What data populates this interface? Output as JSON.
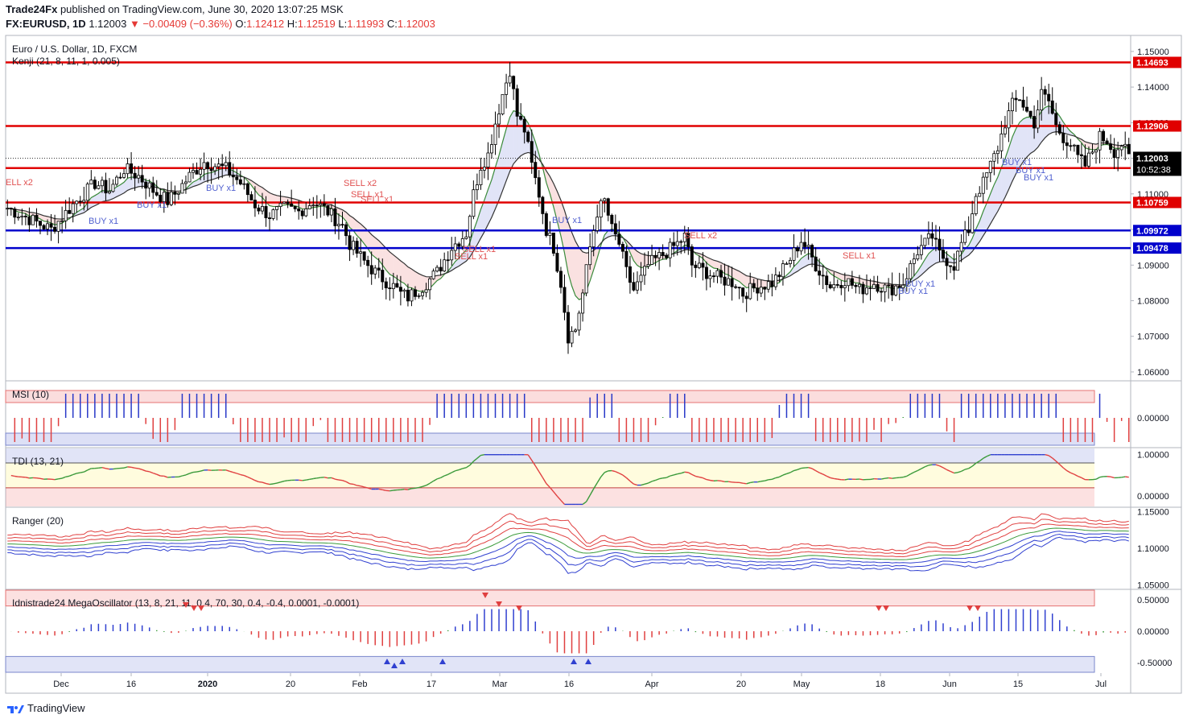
{
  "header": {
    "publisher": "Trade24Fx",
    "published_text": "published on TradingView.com, June 30, 2020 13:07:25 MSK",
    "symbol": "FX:EURUSD, 1D",
    "last": "1.12003",
    "change": "▼ −0.00409 (−0.36%)",
    "o_label": "O:",
    "o_value": "1.12412",
    "h_label": "H:",
    "h_value": "1.12519",
    "l_label": "L:",
    "l_value": "1.11993",
    "c_label": "C:",
    "c_value": "1.12003"
  },
  "footer": {
    "brand": "TradingView"
  },
  "colors": {
    "up": "#ffffff",
    "down": "#000000",
    "red_line": "#e00000",
    "blue_line": "#0000cc",
    "buy": "#5060d0",
    "sell": "#e05050"
  },
  "chart_data": [
    {
      "type": "candlestick",
      "title": "Euro / U.S. Dollar, 1D, FXCM",
      "indicator_label": "Kenji (21, 8, 11, 1, 0.005)",
      "ylim": [
        1.0575,
        1.1545
      ],
      "y_ticks": [
        "1.15000",
        "1.14000",
        "1.13000",
        "1.12000",
        "1.11000",
        "1.10000",
        "1.09000",
        "1.08000",
        "1.07000",
        "1.06000"
      ],
      "x_labels": [
        "Dec",
        "16",
        "2020",
        "20",
        "Feb",
        "17",
        "Mar",
        "16",
        "Apr",
        "20",
        "May",
        "18",
        "Jun",
        "15",
        "Jul"
      ],
      "horizontal_levels": [
        {
          "value": 1.14693,
          "label": "1.14693",
          "color": "#e00000"
        },
        {
          "value": 1.12906,
          "label": "1.12906",
          "color": "#e00000"
        },
        {
          "value": 1.11726,
          "label": "1.11726",
          "color": "#e00000"
        },
        {
          "value": 1.10759,
          "label": "1.10759",
          "color": "#e00000"
        },
        {
          "value": 1.09972,
          "label": "1.09972",
          "color": "#0000cc"
        },
        {
          "value": 1.09478,
          "label": "1.09478",
          "color": "#0000cc"
        }
      ],
      "current_price": {
        "value": 1.12003,
        "label": "1.12003",
        "countdown": "10:52:38"
      },
      "signals": [
        "ELL x2",
        "BUY x1",
        "BUY x1",
        "BUY x1",
        "SELL x2",
        "SELL x1",
        "SELL x1",
        "SELL x1",
        "SELL x1",
        "BUY x1",
        "SELL x2",
        "SELL x1",
        "BUY x1",
        "BUY x1",
        "BUY x1",
        "BUY x1",
        "BUY x1"
      ],
      "close_path": [
        [
          0,
          1.106
        ],
        [
          6,
          1.103
        ],
        [
          12,
          1.1
        ],
        [
          18,
          1.107
        ],
        [
          24,
          1.113
        ],
        [
          28,
          1.111
        ],
        [
          32,
          1.117
        ],
        [
          36,
          1.115
        ],
        [
          40,
          1.111
        ],
        [
          44,
          1.108
        ],
        [
          46,
          1.11
        ],
        [
          50,
          1.115
        ],
        [
          54,
          1.119
        ],
        [
          60,
          1.117
        ],
        [
          64,
          1.113
        ],
        [
          68,
          1.107
        ],
        [
          72,
          1.104
        ],
        [
          76,
          1.106
        ],
        [
          80,
          1.105
        ],
        [
          84,
          1.108
        ],
        [
          88,
          1.105
        ],
        [
          92,
          1.101
        ],
        [
          94,
          1.096
        ],
        [
          98,
          1.091
        ],
        [
          102,
          1.087
        ],
        [
          106,
          1.084
        ],
        [
          108,
          1.082
        ],
        [
          110,
          1.081
        ],
        [
          114,
          1.084
        ],
        [
          118,
          1.088
        ],
        [
          122,
          1.095
        ],
        [
          126,
          1.099
        ],
        [
          128,
          1.11
        ],
        [
          130,
          1.118
        ],
        [
          132,
          1.121
        ],
        [
          134,
          1.13
        ],
        [
          136,
          1.138
        ],
        [
          138,
          1.145
        ],
        [
          140,
          1.132
        ],
        [
          142,
          1.128
        ],
        [
          144,
          1.118
        ],
        [
          146,
          1.11
        ],
        [
          148,
          1.1
        ],
        [
          150,
          1.095
        ],
        [
          152,
          1.085
        ],
        [
          154,
          1.07
        ],
        [
          156,
          1.072
        ],
        [
          158,
          1.082
        ],
        [
          160,
          1.095
        ],
        [
          162,
          1.105
        ],
        [
          164,
          1.108
        ],
        [
          166,
          1.1
        ],
        [
          168,
          1.096
        ],
        [
          170,
          1.088
        ],
        [
          172,
          1.083
        ],
        [
          174,
          1.086
        ],
        [
          176,
          1.09
        ],
        [
          180,
          1.093
        ],
        [
          184,
          1.096
        ],
        [
          186,
          1.098
        ],
        [
          188,
          1.09
        ],
        [
          192,
          1.088
        ],
        [
          196,
          1.086
        ],
        [
          200,
          1.085
        ],
        [
          202,
          1.082
        ],
        [
          206,
          1.084
        ],
        [
          210,
          1.085
        ],
        [
          214,
          1.09
        ],
        [
          218,
          1.097
        ],
        [
          220,
          1.094
        ],
        [
          222,
          1.09
        ],
        [
          226,
          1.084
        ],
        [
          230,
          1.086
        ],
        [
          234,
          1.083
        ],
        [
          238,
          1.085
        ],
        [
          242,
          1.083
        ],
        [
          246,
          1.085
        ],
        [
          250,
          1.094
        ],
        [
          254,
          1.098
        ],
        [
          256,
          1.093
        ],
        [
          260,
          1.09
        ],
        [
          262,
          1.096
        ],
        [
          264,
          1.1
        ],
        [
          266,
          1.11
        ],
        [
          268,
          1.113
        ],
        [
          270,
          1.118
        ],
        [
          272,
          1.123
        ],
        [
          274,
          1.13
        ],
        [
          276,
          1.135
        ],
        [
          278,
          1.137
        ],
        [
          280,
          1.133
        ],
        [
          282,
          1.13
        ],
        [
          284,
          1.138
        ],
        [
          286,
          1.136
        ],
        [
          288,
          1.129
        ],
        [
          290,
          1.126
        ],
        [
          292,
          1.124
        ],
        [
          294,
          1.12
        ],
        [
          296,
          1.118
        ],
        [
          298,
          1.122
        ],
        [
          300,
          1.126
        ],
        [
          302,
          1.125
        ],
        [
          304,
          1.122
        ],
        [
          306,
          1.124
        ],
        [
          308,
          1.12
        ]
      ]
    },
    {
      "type": "bar",
      "title": "MSI (10)",
      "ylim": [
        -0.05,
        0.05
      ],
      "y_ticks": [
        "0.00000"
      ]
    },
    {
      "type": "line",
      "title": "TDI (13, 21)",
      "ylim": [
        -0.25,
        1.15
      ],
      "y_ticks": [
        "1.00000",
        "0.00000"
      ]
    },
    {
      "type": "line",
      "title": "Ranger (20)",
      "ylim": [
        1.045,
        1.155
      ],
      "y_ticks": [
        "1.15000",
        "1.10000",
        "1.05000"
      ]
    },
    {
      "type": "bar",
      "title": "Idnistrade24 MegaOscillator (13, 8, 21, 11, 0.4, 70, 30, 0.4, -0.4, 0.0001, -0.0001)",
      "ylim": [
        -0.65,
        0.65
      ],
      "y_ticks": [
        "0.50000",
        "0.00000",
        "-0.50000"
      ]
    }
  ]
}
